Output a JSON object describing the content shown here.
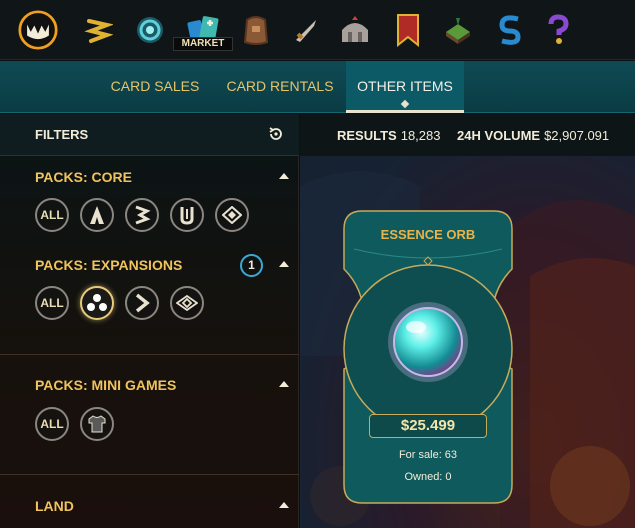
{
  "nav": {
    "market_label": "MARKET",
    "icons": [
      "splinterlands-logo-icon",
      "rewards-icon",
      "portal-icon",
      "market-icon",
      "inventory-icon",
      "battle-icon",
      "guild-icon",
      "ranked-icon",
      "land-icon",
      "sps-icon",
      "help-icon"
    ]
  },
  "tabs": [
    {
      "label": "CARD SALES"
    },
    {
      "label": "CARD RENTALS"
    },
    {
      "label": "OTHER ITEMS",
      "active": true
    }
  ],
  "filters": {
    "title": "FILTERS",
    "sections": [
      {
        "title": "PACKS: CORE",
        "options": [
          "ALL",
          "alpha-icon",
          "beta-icon",
          "untamed-icon",
          "chaos-icon"
        ]
      },
      {
        "title": "PACKS: EXPANSIONS",
        "badge": "1",
        "options": [
          "ALL",
          "dots-icon",
          "arrow-icon",
          "diamond-icon"
        ]
      },
      {
        "title": "PACKS: MINI GAMES",
        "options": [
          "ALL",
          "shirt-icon"
        ]
      },
      {
        "title": "LAND"
      }
    ],
    "all_label": "ALL"
  },
  "results": {
    "label": "RESULTS",
    "value": "18,283",
    "volume_label": "24H VOLUME",
    "volume_value": "$2,907.091"
  },
  "item": {
    "name": "ESSENCE ORB",
    "price": "$25.499",
    "for_sale": "For sale: 63",
    "owned": "Owned: 0"
  },
  "colors": {
    "accent": "#f0c35c",
    "teal": "#0f4a54",
    "badge": "#39a9d8"
  }
}
